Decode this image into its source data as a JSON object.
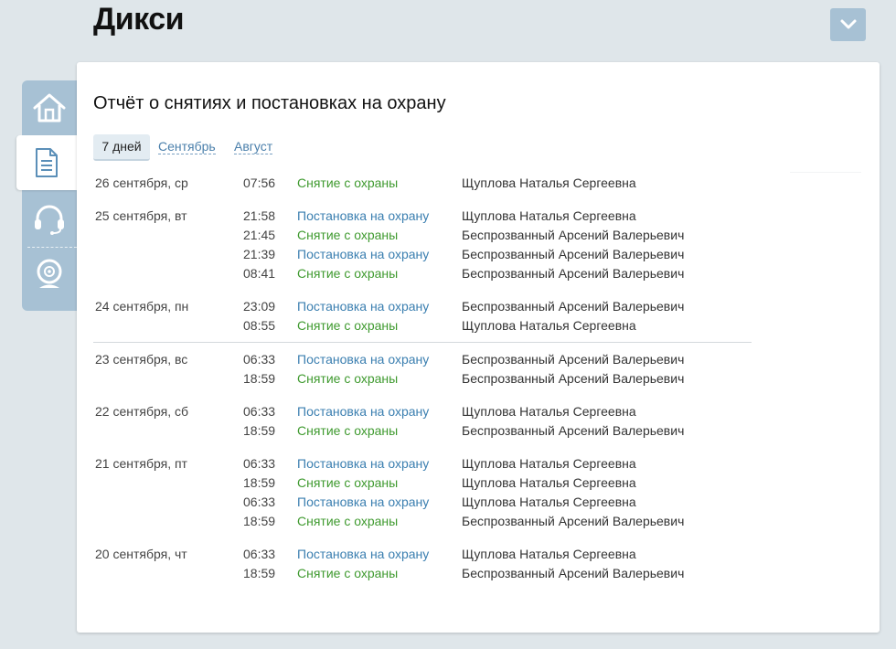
{
  "header": {
    "title": "Дикси"
  },
  "nav": {
    "items": [
      {
        "id": "home",
        "icon": "house-icon"
      },
      {
        "id": "reports",
        "icon": "document-icon",
        "active": true
      },
      {
        "id": "support",
        "icon": "headset-icon"
      },
      {
        "id": "camera",
        "icon": "webcam-icon"
      }
    ]
  },
  "report": {
    "title": "Отчёт о снятиях и постановках на охрану",
    "tabs": [
      {
        "label": "7 дней",
        "selected": true
      },
      {
        "label": "Сентябрь",
        "selected": false
      },
      {
        "label": "Август",
        "selected": false
      }
    ],
    "days": [
      {
        "date": "26 сентября, ср",
        "events": [
          {
            "time": "07:56",
            "action": "Снятие с охраны",
            "type": "disarm",
            "user": "Щуплова Наталья Сергеевна"
          }
        ]
      },
      {
        "date": "25 сентября, вт",
        "events": [
          {
            "time": "21:58",
            "action": "Постановка на охрану",
            "type": "arm",
            "user": "Щуплова Наталья Сергеевна"
          },
          {
            "time": "21:45",
            "action": "Снятие с охраны",
            "type": "disarm",
            "user": "Беспрозванный Арсений Валерьевич"
          },
          {
            "time": "21:39",
            "action": "Постановка на охрану",
            "type": "arm",
            "user": "Беспрозванный Арсений Валерьевич"
          },
          {
            "time": "08:41",
            "action": "Снятие с охраны",
            "type": "disarm",
            "user": "Беспрозванный Арсений Валерьевич"
          }
        ]
      },
      {
        "date": "24 сентября, пн",
        "events": [
          {
            "time": "23:09",
            "action": "Постановка на охрану",
            "type": "arm",
            "user": "Беспрозванный Арсений Валерьевич"
          },
          {
            "time": "08:55",
            "action": "Снятие с охраны",
            "type": "disarm",
            "user": "Щуплова Наталья Сергеевна"
          }
        ]
      },
      {
        "date": "23 сентября, вс",
        "events": [
          {
            "time": "06:33",
            "action": "Постановка на охрану",
            "type": "arm",
            "user": "Беспрозванный Арсений Валерьевич"
          },
          {
            "time": "18:59",
            "action": "Снятие с охраны",
            "type": "disarm",
            "user": "Беспрозванный Арсений Валерьевич"
          }
        ]
      },
      {
        "date": "22 сентября, сб",
        "events": [
          {
            "time": "06:33",
            "action": "Постановка на охрану",
            "type": "arm",
            "user": "Щуплова Наталья Сергеевна"
          },
          {
            "time": "18:59",
            "action": "Снятие с охраны",
            "type": "disarm",
            "user": "Беспрозванный Арсений Валерьевич"
          }
        ]
      },
      {
        "date": "21 сентября, пт",
        "events": [
          {
            "time": "06:33",
            "action": "Постановка на охрану",
            "type": "arm",
            "user": "Щуплова Наталья Сергеевна"
          },
          {
            "time": "18:59",
            "action": "Снятие с охраны",
            "type": "disarm",
            "user": "Щуплова Наталья Сергеевна"
          },
          {
            "time": "06:33",
            "action": "Постановка на охрану",
            "type": "arm",
            "user": "Щуплова Наталья Сергеевна"
          },
          {
            "time": "18:59",
            "action": "Снятие с охраны",
            "type": "disarm",
            "user": "Беспрозванный Арсений Валерьевич"
          }
        ]
      },
      {
        "date": "20 сентября, чт",
        "events": [
          {
            "time": "06:33",
            "action": "Постановка на охрану",
            "type": "arm",
            "user": "Щуплова Наталья Сергеевна"
          },
          {
            "time": "18:59",
            "action": "Снятие с охраны",
            "type": "disarm",
            "user": "Беспрозванный Арсений Валерьевич"
          }
        ]
      }
    ]
  },
  "colors": {
    "background": "#dfe6ea",
    "sidebar": "#a7c1d4",
    "arm": "#3b7fb0",
    "disarm": "#3f9a2f",
    "link": "#4a7fab"
  }
}
